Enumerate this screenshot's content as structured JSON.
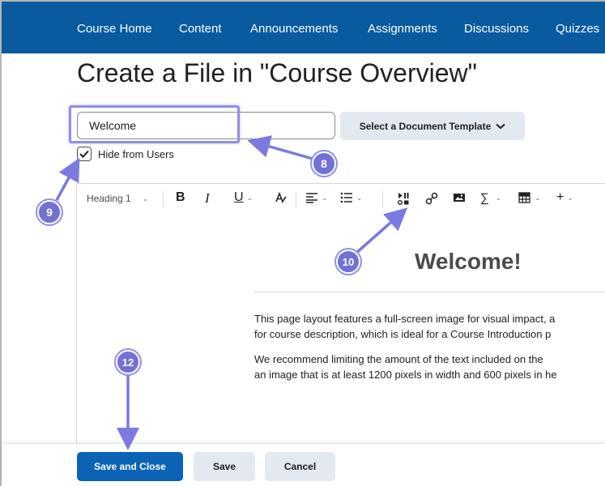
{
  "nav": {
    "items": [
      "Course Home",
      "Content",
      "Announcements",
      "Assignments",
      "Discussions",
      "Quizzes"
    ]
  },
  "page": {
    "title": "Create a File in \"Course Overview\""
  },
  "form": {
    "title_value": "Welcome",
    "template_button": "Select a Document Template",
    "hide_label": "Hide from Users",
    "hide_checked": true
  },
  "toolbar": {
    "format": "Heading 1",
    "bold": "B",
    "italic": "I",
    "underline": "U"
  },
  "document": {
    "heading": "Welcome!",
    "paragraph1": [
      "This page layout features a full-screen image for visual impact, a",
      "for course description, which is ideal for a Course Introduction p"
    ],
    "paragraph2": [
      "We recommend limiting the amount of the text included on the",
      "an image that is at least 1200 pixels in width and 600 pixels in he"
    ]
  },
  "actions": {
    "save_close": "Save and Close",
    "save": "Save",
    "cancel": "Cancel"
  },
  "callouts": [
    "8",
    "9",
    "10",
    "12"
  ],
  "colors": {
    "nav_bg": "#0a5aa0",
    "primary": "#0b63b6",
    "callout": "#7171d6",
    "secondary_bg": "#e3e9f1"
  }
}
